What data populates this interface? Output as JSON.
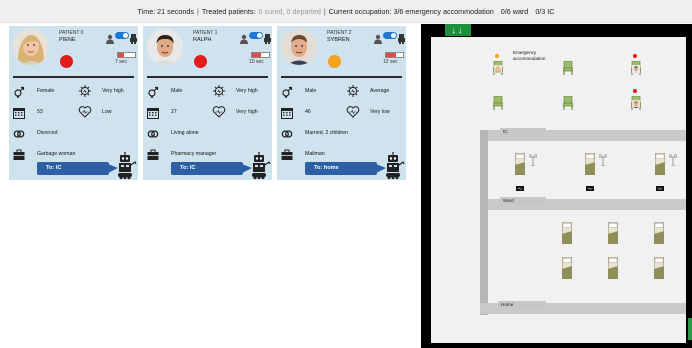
{
  "status": {
    "time_label": "Time: 21 seconds",
    "sep": "|",
    "treated_label": "Treated patients:",
    "treated_detail": "0 cured, 0 departed",
    "occupation_label": "Current occupation: 3/6 emergency accommodation",
    "ward": "0/6 ward",
    "ic": "0/3 IC"
  },
  "patients": [
    {
      "number": "PATIENT 0",
      "name": "PIENE",
      "status_color": "#e21c1c",
      "timer": "7 sec",
      "timer_fraction": 0.35,
      "gender": "Female",
      "age": "53",
      "relationship": "Divorced",
      "job": "Garbage woman",
      "risk1": "Very high",
      "risk2": "Low",
      "action": "To: IC"
    },
    {
      "number": "PATIENT 1",
      "name": "RALPH",
      "status_color": "#e21c1c",
      "timer": "10 sec",
      "timer_fraction": 0.5,
      "gender": "Male",
      "age": "27",
      "relationship": "Living alone",
      "job": "Pharmacy manager",
      "risk1": "Very high",
      "risk2": "Very high",
      "action": "To: IC"
    },
    {
      "number": "PATIENT 2",
      "name": "SYBREN",
      "status_color": "#f4a21e",
      "timer": "12 sec",
      "timer_fraction": 0.6,
      "gender": "Male",
      "age": "46",
      "relationship": "Married, 2 children",
      "job": "Mailman",
      "risk1": "Average",
      "risk2": "Very low",
      "action": "To: home"
    }
  ],
  "map": {
    "exit_icon": "↓↓",
    "emergency_label": "Emergency accommodation",
    "ic_label": "IC",
    "ward_label": "Ward",
    "home_label": "Home"
  },
  "icons": [
    "person-icon",
    "toggle-switch-icon",
    "robot-icon",
    "gender-icon",
    "age-calendar-icon",
    "rings-icon",
    "briefcase-icon",
    "virus-icon",
    "heart-icon"
  ]
}
